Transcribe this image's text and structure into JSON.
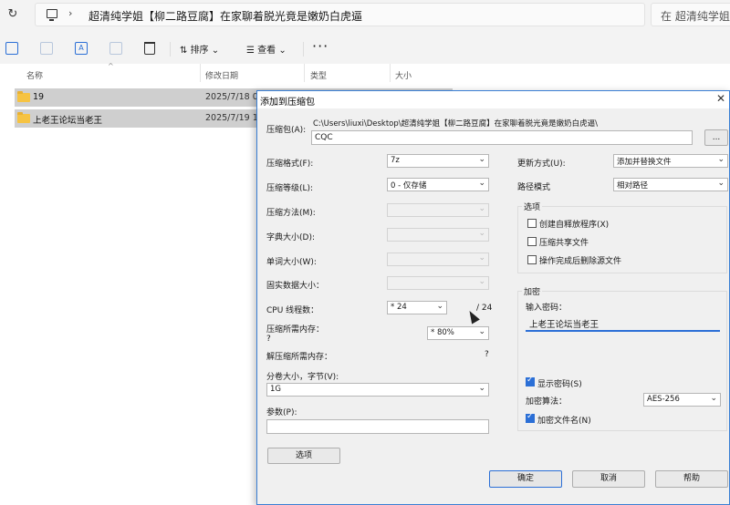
{
  "address": {
    "path": "超清纯学姐【柳二路豆腐】在家聊着脱光竟是嫩奶白虎逼",
    "search_placeholder": "在 超清纯学姐"
  },
  "toolbar": {
    "sort_label": "排序",
    "view_label": "查看",
    "more_label": "···"
  },
  "file_list": {
    "columns": [
      "名称",
      "修改日期",
      "类型",
      "大小"
    ],
    "rows": [
      {
        "name": "19",
        "date": "2025/7/18 0"
      },
      {
        "name": "上老王论坛当老王",
        "date": "2025/7/19 1"
      }
    ]
  },
  "dialog": {
    "title": "添加到压缩包",
    "archive_label": "压缩包(A):",
    "archive_path": "C:\\Users\\liuxi\\Desktop\\超清纯学姐【柳二路豆腐】在家聊着脱光竟是嫩奶白虎逼\\",
    "archive_name": "CQC",
    "browse_label": "...",
    "left": {
      "format_label": "压缩格式(F):",
      "format_value": "7z",
      "level_label": "压缩等级(L):",
      "level_value": "0 - 仅存储",
      "method_label": "压缩方法(M):",
      "dict_label": "字典大小(D):",
      "word_label": "单词大小(W):",
      "solid_label": "固实数据大小：",
      "threads_label": "CPU 线程数：",
      "threads_value": "* 24",
      "threads_max": "/ 24",
      "mem_comp_label": "压缩所需内存：",
      "mem_comp_q": "?",
      "mem_comp_value": "* 80%",
      "mem_decomp_label": "解压缩所需内存：",
      "mem_decomp_q": "?",
      "split_label": "分卷大小，字节(V):",
      "split_value": "1G",
      "params_label": "参数(P):",
      "options_button": "选项"
    },
    "right": {
      "update_label": "更新方式(U):",
      "update_value": "添加并替换文件",
      "path_label": "路径模式",
      "path_value": "相对路径",
      "options_group": "选项",
      "opt_sfx": "创建自释放程序(X)",
      "opt_shared": "压缩共享文件",
      "opt_delete": "操作完成后删除源文件",
      "encrypt_group": "加密",
      "password_label": "输入密码：",
      "password_value": "上老王论坛当老王",
      "show_pw_label": "显示密码(S)",
      "method_label": "加密算法：",
      "method_value": "AES-256",
      "encrypt_names_label": "加密文件名(N)"
    },
    "buttons": {
      "ok": "确定",
      "cancel": "取消",
      "help": "帮助"
    }
  }
}
